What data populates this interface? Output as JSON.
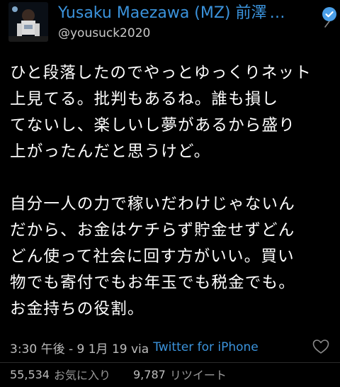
{
  "tweet": {
    "display_name": "Yusaku Maezawa (MZ) 前澤",
    "ellipsis": "…",
    "handle": "@yousuck2020",
    "body_lines": [
      "ひと段落したのでやっとゆっくりネット",
      "上見てる。批判もあるね。誰も損し",
      "てないし、楽しいし夢があるから盛り",
      "上がったんだと思うけど。",
      "",
      "自分一人の力で稼いだわけじゃないん",
      "だから、お金はケチらず貯金せずどん",
      "どん使って社会に回す方がいい。買い",
      "物でも寄付でもお年玉でも税金でも。",
      "お金持ちの役割。"
    ],
    "timestamp": "3:30 午後 - 9 1月 19 via",
    "via_client": "Twitter for iPhone",
    "favorites_count": "55,534",
    "favorites_label": "お気に入り",
    "retweets_count": "9,787",
    "retweets_label": "リツイート"
  },
  "icons": {
    "avatar": "avatar",
    "verified": "verified-badge-icon",
    "chevron": "chevron-right-icon",
    "heart": "heart-outline-icon"
  },
  "colors": {
    "background": "#000000",
    "link_blue": "#3b93dc",
    "text": "#ffffff",
    "muted": "#bdbdbd"
  }
}
